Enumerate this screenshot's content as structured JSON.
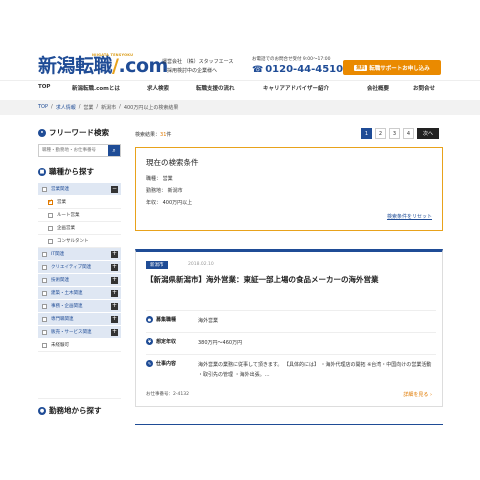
{
  "header": {
    "logo": "新潟転職",
    "logo_suffix": ".com",
    "logo_sub": "NIIGATA TENSYOKU",
    "company_line1": "運営会社 （株）スタッフエース",
    "company_line2": "・採用検討中の企業様へ",
    "phone_label": "お電話でのお問合せ受付 9:00〜17:00",
    "phone": "0120-44-4510",
    "cta_free": "無料",
    "cta_label": "転職サポートお申し込み"
  },
  "nav": {
    "items": [
      "TOP",
      "新潟転職.comとは",
      "求人検索",
      "転職支援の流れ",
      "キャリアアドバイザー紹介",
      "会社概要",
      "お問合せ"
    ]
  },
  "breadcrumb": {
    "items": [
      "TOP",
      "求人情報",
      "営業",
      "新潟市",
      "400万円以上の検索結果"
    ]
  },
  "sidebar": {
    "freeword_title": "フリーワード検索",
    "search_placeholder": "職種・勤務地・お仕事番号",
    "job_title": "職種から探す",
    "categories": [
      {
        "label": "営業関連",
        "checked": false,
        "toggle": "−",
        "style": "blue"
      },
      {
        "label": "営業",
        "checked": true,
        "style": "sub"
      },
      {
        "label": "ルート営業",
        "checked": false,
        "style": "sub"
      },
      {
        "label": "企画営業",
        "checked": false,
        "style": "sub"
      },
      {
        "label": "コンサルタント",
        "checked": false,
        "style": "sub"
      },
      {
        "label": "IT関連",
        "checked": false,
        "toggle": "+",
        "style": "blue"
      },
      {
        "label": "クリエイティブ関連",
        "checked": false,
        "toggle": "+",
        "style": "blue"
      },
      {
        "label": "技術関連",
        "checked": false,
        "toggle": "+",
        "style": "blue"
      },
      {
        "label": "建築・土木関連",
        "checked": false,
        "toggle": "+",
        "style": "blue"
      },
      {
        "label": "事務・企画関連",
        "checked": false,
        "toggle": "+",
        "style": "blue"
      },
      {
        "label": "専門職関連",
        "checked": false,
        "toggle": "+",
        "style": "blue"
      },
      {
        "label": "販売・サービス関連",
        "checked": false,
        "toggle": "+",
        "style": "blue"
      },
      {
        "label": "未経験可",
        "checked": false,
        "style": "white"
      }
    ],
    "location_title": "勤務地から探す"
  },
  "results": {
    "label": "検索結果：",
    "count": "31",
    "suffix": "件",
    "pages": [
      "1",
      "2",
      "3",
      "4"
    ],
    "active_page": "1",
    "next_label": "次へ"
  },
  "conditions": {
    "title": "現在の検索条件",
    "lines": [
      "職種： 営業",
      "勤務地： 新潟市",
      "年収： 400万円以上"
    ],
    "reset_label": "検索条件をリセット"
  },
  "job": {
    "tag": "新潟市",
    "date": "2018.02.10",
    "title": "【新潟県新潟市】海外営業：東証一部上場の食品メーカーの海外営業",
    "rows": [
      {
        "label": "募集職種",
        "value": "海外営業"
      },
      {
        "label": "想定年収",
        "value": "380万円〜460万円"
      },
      {
        "label": "仕事内容",
        "value": "海外営業の業務に従事して頂きます。 【具体的には】 ・海外代理店の開拓 ※台湾・中国向けの営業活動 ・取引先の管理 ・海外出張。…"
      }
    ],
    "id_label": "お仕事番号：2-4132",
    "more_label": "詳細を見る ›"
  },
  "colors": {
    "brand": "#1f4c96",
    "accent": "#ea8a00"
  }
}
